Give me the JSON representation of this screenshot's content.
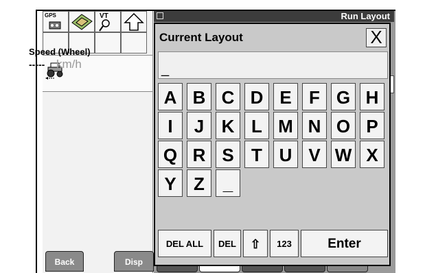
{
  "left_panel": {
    "gps_label": "GPS",
    "vt_label": "VT",
    "speed_title": "Speed (Wheel)",
    "speed_value": "-----",
    "speed_unit": "km/h",
    "back_label": "Back",
    "disp_label": "Disp"
  },
  "window": {
    "title": "Run Layout"
  },
  "dialog": {
    "title": "Current Layout",
    "input_value": "_",
    "close_label": "X",
    "keys": [
      "A",
      "B",
      "C",
      "D",
      "E",
      "F",
      "G",
      "H",
      "I",
      "J",
      "K",
      "L",
      "M",
      "N",
      "O",
      "P",
      "Q",
      "R",
      "S",
      "T",
      "U",
      "V",
      "W",
      "X",
      "Y",
      "Z",
      "_"
    ],
    "del_all_label": "DEL ALL",
    "del_label": "DEL",
    "shift_label": "⇧",
    "num_label": "123",
    "enter_label": "Enter"
  }
}
